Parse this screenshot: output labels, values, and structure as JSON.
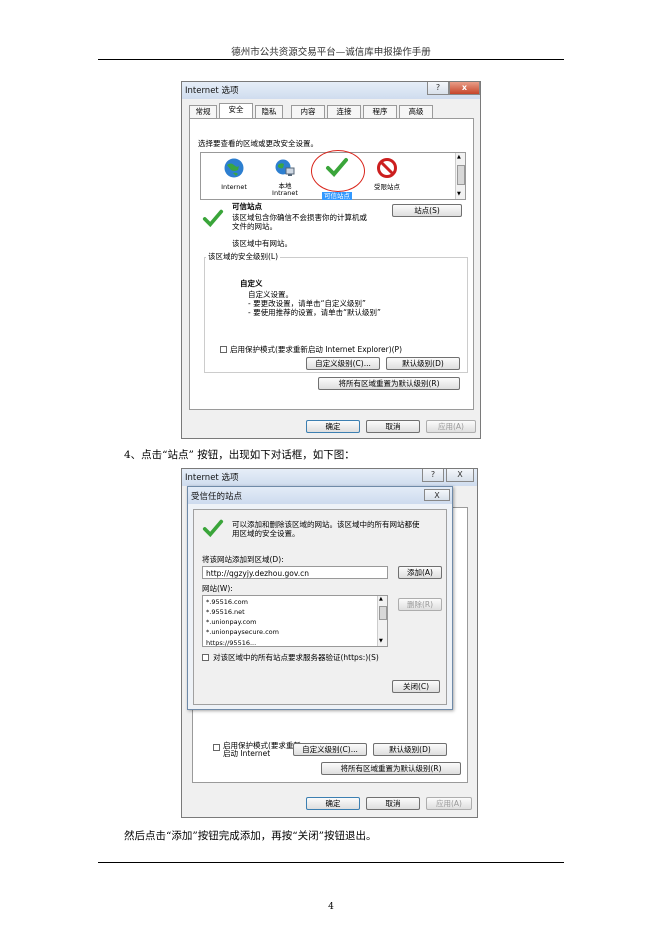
{
  "header": {
    "title": "德州市公共资源交易平台—诚信库申报操作手册"
  },
  "page_number": "4",
  "step4_text": "4、点击“站点” 按钮，出现如下对话框，如下图：",
  "final_text": "然后点击“添加”按钮完成添加，再按“关闭”按钮退出。",
  "dialog1": {
    "title": "Internet 选项",
    "title_help": "?",
    "title_close": "x",
    "tabs": [
      "常规",
      "安全",
      "隐私",
      "内容",
      "连接",
      "程序",
      "高级"
    ],
    "zone_prompt": "选择要查看的区域或更改安全设置。",
    "zones": [
      "Internet",
      "本地\nIntranet",
      "可信站点",
      "受限站点"
    ],
    "zone_title": "可信站点",
    "zone_desc": "该区域包含你确信不会损害你的计算机或\n文件的网站。",
    "zone_note": "该区域中有网站。",
    "sites_button": "站点(S)",
    "security_level_label": "该区域的安全级别(L)",
    "custom_title": "自定义",
    "custom_lines": [
      "自定义设置。",
      "- 要更改设置，请单击“自定义级别”",
      "- 要使用推荐的设置，请单击“默认级别”"
    ],
    "protected_mode": "启用保护模式(要求重新启动 Internet Explorer)(P)",
    "custom_level_button": "自定义级别(C)...",
    "default_level_button": "默认级别(D)",
    "reset_all_button": "将所有区域重置为默认级别(R)",
    "ok": "确定",
    "cancel": "取消",
    "apply": "应用(A)"
  },
  "dialog2": {
    "outer_title": "Internet 选项",
    "outer_help": "?",
    "outer_close": "X",
    "title": "受信任的站点",
    "close_x": "X",
    "info": "可以添加和删除该区域的网站。该区域中的所有网站都使\n用区域的安全设置。",
    "add_label": "将该网站添加到区域(D):",
    "add_value": "http://qgzyjy.dezhou.gov.cn",
    "add_button": "添加(A)",
    "sites_label": "网站(W):",
    "sites": [
      "*.95516.com",
      "*.95516.net",
      "*.unionpay.com",
      "*.unionpaysecure.com",
      "https://95516..."
    ],
    "remove_button": "删除(R)",
    "https_check": "对该区域中的所有站点要求服务器验证(https:)(S)",
    "close_button": "关闭(C)",
    "behind_protected": "启用保护模式(要求重新\n启动 Internet",
    "behind_custom": "自定义级别(C)...",
    "behind_default": "默认级别(D)",
    "behind_reset": "将所有区域重置为默认级别(R)",
    "ok": "确定",
    "cancel": "取消",
    "apply": "应用(A)"
  },
  "colors": {
    "check_green": "#3aa53a",
    "highlight_red": "#d9261c",
    "selection_blue": "#3399ff",
    "restricted_red": "#cc1f1f"
  }
}
